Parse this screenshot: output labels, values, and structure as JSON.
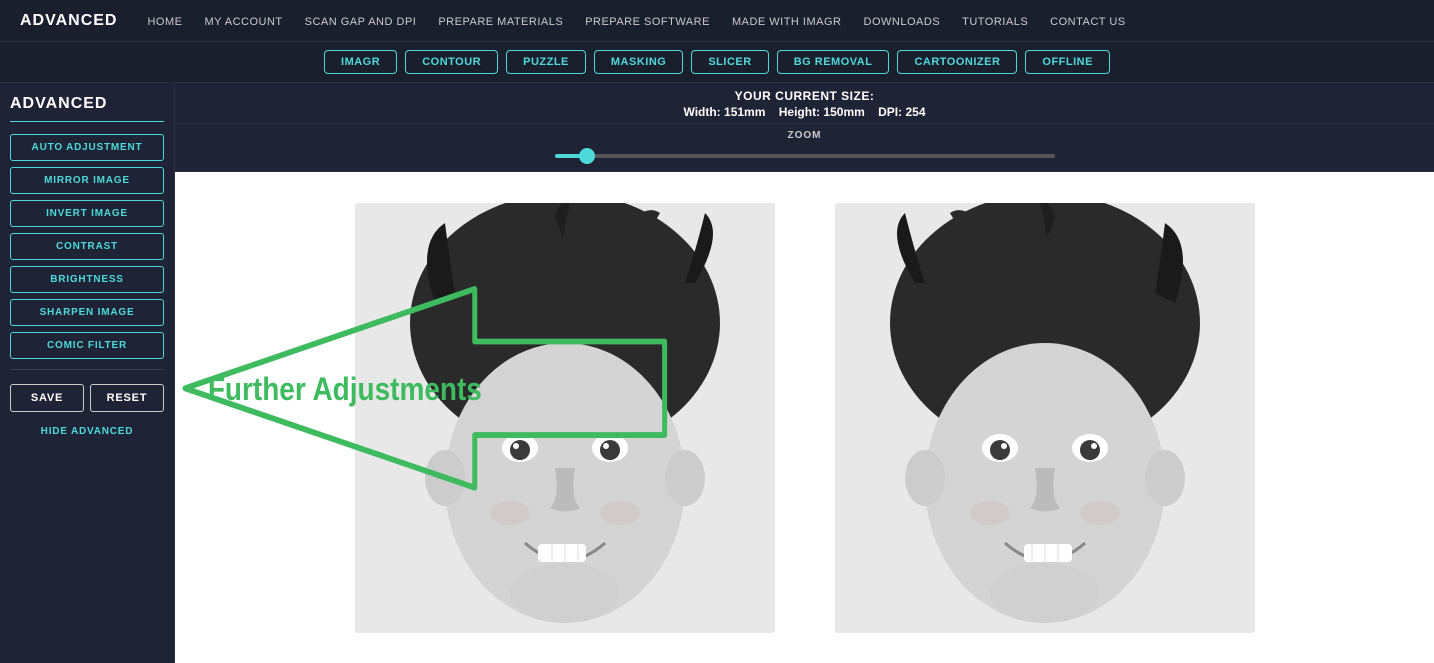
{
  "brand": "ADVANCED",
  "nav": {
    "links": [
      {
        "id": "home",
        "label": "HOME"
      },
      {
        "id": "my-account",
        "label": "MY ACCOUNT"
      },
      {
        "id": "scan-gap",
        "label": "SCAN GAP AND DPI"
      },
      {
        "id": "prepare-materials",
        "label": "PREPARE MATERIALS"
      },
      {
        "id": "prepare-software",
        "label": "PREPARE SOFTWARE"
      },
      {
        "id": "made-with",
        "label": "MADE WITH IMAGR"
      },
      {
        "id": "downloads",
        "label": "DOWNLOADS"
      },
      {
        "id": "tutorials",
        "label": "TUTORIALS"
      },
      {
        "id": "contact",
        "label": "CONTACT US"
      }
    ]
  },
  "tabs": [
    {
      "id": "imagr",
      "label": "IMAGR"
    },
    {
      "id": "contour",
      "label": "CONTOUR"
    },
    {
      "id": "puzzle",
      "label": "PUZZLE"
    },
    {
      "id": "masking",
      "label": "MASKING"
    },
    {
      "id": "slicer",
      "label": "SLICER"
    },
    {
      "id": "bg-removal",
      "label": "BG REMOVAL"
    },
    {
      "id": "cartoonizer",
      "label": "CARTOONIZER"
    },
    {
      "id": "offline",
      "label": "OFFLINE"
    }
  ],
  "sidebar": {
    "title": "ADVANCED",
    "buttons": [
      {
        "id": "auto-adjustment",
        "label": "AUTO ADJUSTMENT"
      },
      {
        "id": "mirror-image",
        "label": "MIRROR IMAGE"
      },
      {
        "id": "invert-image",
        "label": "INVERT IMAGE"
      },
      {
        "id": "contrast",
        "label": "CONTRAST"
      },
      {
        "id": "brightness",
        "label": "BRIGHTNESS"
      },
      {
        "id": "sharpen-image",
        "label": "SHARPEN IMAGE"
      },
      {
        "id": "comic-filter",
        "label": "COMIC FILTER"
      }
    ],
    "save_label": "SAVE",
    "reset_label": "RESET",
    "hide_label": "HIDE ADVANCED"
  },
  "size_info": {
    "title": "YOUR CURRENT SIZE:",
    "width_label": "Width:",
    "width_value": "151mm",
    "height_label": "Height:",
    "height_value": "150mm",
    "dpi_label": "DPI:",
    "dpi_value": "254"
  },
  "zoom": {
    "label": "ZOOM",
    "value": 5
  },
  "annotation": {
    "text": "Further Adjustments"
  },
  "colors": {
    "accent": "#4dd9d9",
    "background": "#1a1f2e",
    "sidebar": "#1e2435",
    "arrow_stroke": "#3dbb5e"
  }
}
